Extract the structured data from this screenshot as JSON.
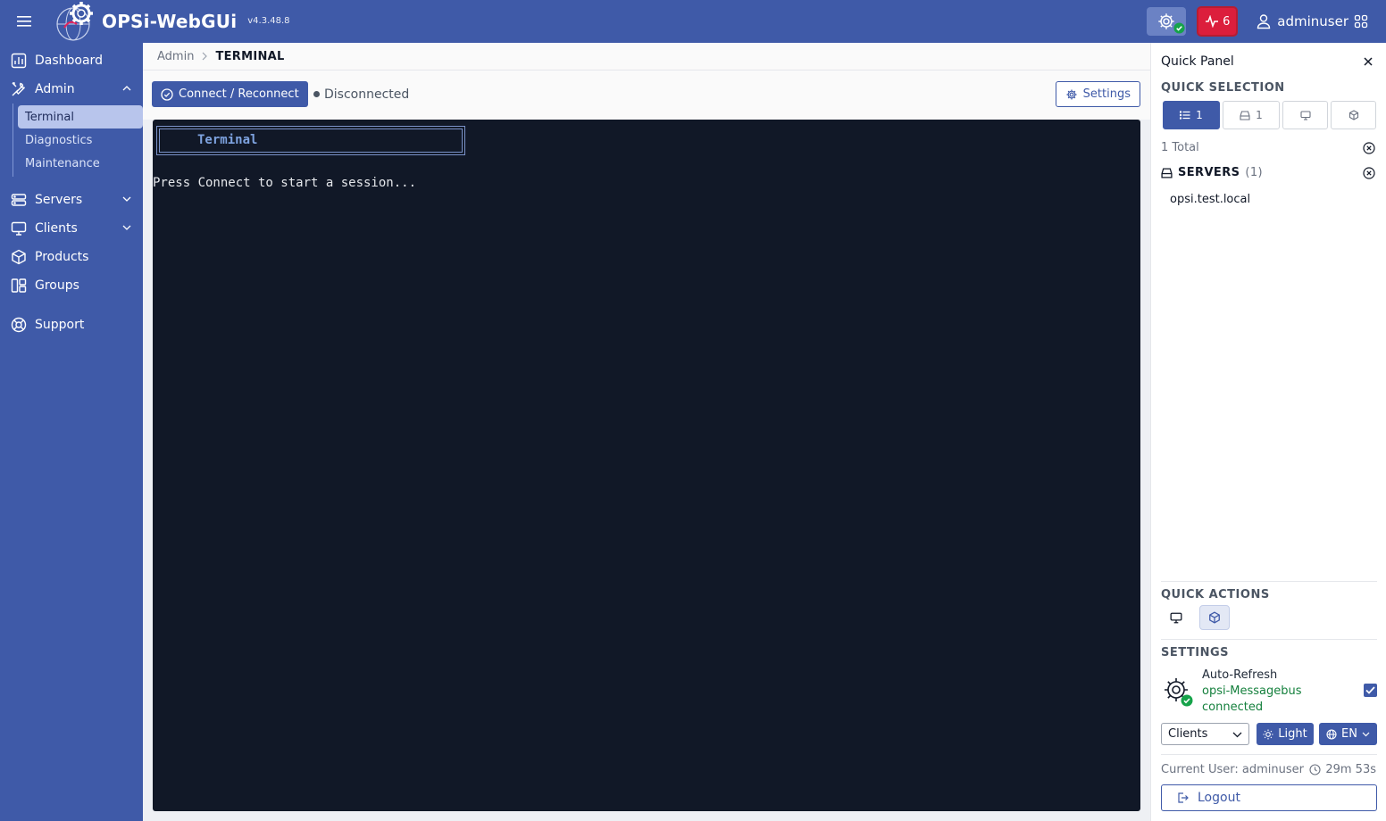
{
  "header": {
    "brand": "OPSi-WebGUi",
    "version": "v4.3.48.8",
    "alert_count": "6",
    "username": "adminuser"
  },
  "sidebar": {
    "items": [
      {
        "label": "Dashboard",
        "icon": "dashboard-icon"
      },
      {
        "label": "Admin",
        "icon": "tools-icon",
        "expanded": true,
        "children": [
          {
            "label": "Terminal",
            "active": true
          },
          {
            "label": "Diagnostics"
          },
          {
            "label": "Maintenance"
          }
        ]
      },
      {
        "label": "Servers",
        "icon": "server-icon"
      },
      {
        "label": "Clients",
        "icon": "monitor-icon"
      },
      {
        "label": "Products",
        "icon": "box-icon"
      },
      {
        "label": "Groups",
        "icon": "groups-icon"
      },
      {
        "label": "Support",
        "icon": "lifebuoy-icon"
      }
    ]
  },
  "breadcrumb": {
    "parent": "Admin",
    "current": "TERMINAL"
  },
  "toolbar": {
    "connect_label": "Connect / Reconnect",
    "status": "Disconnected",
    "settings_label": "Settings"
  },
  "terminal": {
    "title": "Terminal",
    "message": "Press Connect to start a session..."
  },
  "quick_panel": {
    "title": "Quick Panel",
    "quick_selection_title": "QUICK SELECTION",
    "tabs": [
      {
        "icon": "list-icon",
        "count": "1",
        "active": true
      },
      {
        "icon": "server-icon",
        "count": "1"
      },
      {
        "icon": "monitor-icon",
        "count": ""
      },
      {
        "icon": "box-icon",
        "count": ""
      }
    ],
    "total": "1 Total",
    "servers_label": "SERVERS",
    "servers_count": "(1)",
    "servers": [
      "opsi.test.local"
    ],
    "quick_actions_title": "QUICK ACTIONS",
    "settings_title": "SETTINGS",
    "auto_refresh": "Auto-Refresh",
    "messagebus_line1": "opsi-Messagebus",
    "messagebus_line2": "connected",
    "view_select": "Clients",
    "theme_label": "Light",
    "language_label": "EN",
    "current_user": "Current User: adminuser",
    "session_timer": "29m 53s",
    "logout_label": "Logout"
  },
  "colors": {
    "primary": "#3f5aa8",
    "alert": "#dc1e3c",
    "terminal_bg": "#111827",
    "success": "#15803d"
  }
}
